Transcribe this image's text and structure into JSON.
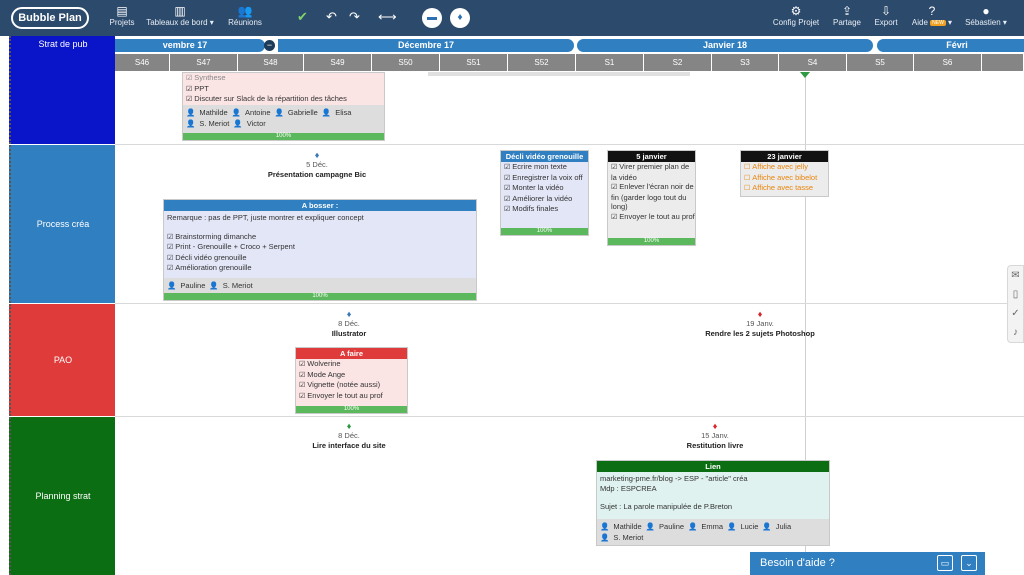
{
  "nav": {
    "logo": "Bubble Plan",
    "projets": "Projets",
    "tableaux": "Tableaux de bord ▾",
    "reunions": "Réunions",
    "config": "Config Projet",
    "partage": "Partage",
    "export": "Export",
    "aide": "Aide",
    "new_badge": "NEW",
    "user": "Sébastien ▾"
  },
  "lanes": [
    "Strat de pub",
    "Process créa",
    "PAO",
    "Planning strat"
  ],
  "months": [
    "vembre 17",
    "Décembre 17",
    "Janvier 18",
    "Févri"
  ],
  "weeks": [
    "S46",
    "S47",
    "S48",
    "S49",
    "S50",
    "S51",
    "S52",
    "S1",
    "S2",
    "S3",
    "S4",
    "S5",
    "S6",
    ""
  ],
  "cards": {
    "c0": {
      "items": [
        "Synthese",
        "PPT",
        "Discuter sur Slack de la répartition des tâches"
      ],
      "users": [
        "Mathilde",
        "Antoine",
        "Gabrielle",
        "Elisa",
        "S. Meriot",
        "Victor"
      ],
      "progress": "100%"
    },
    "c1": {
      "title": "A bosser :",
      "lines": [
        "Remarque : pas de PPT, juste montrer et expliquer concept",
        "",
        "Brainstorming dimanche",
        "Print - Grenouille + Croco + Serpent",
        "Décli vidéo grenouille",
        "Amélioration grenouille"
      ],
      "users": [
        "Pauline",
        "S. Meriot"
      ],
      "progress": "100%"
    },
    "c2": {
      "title": "Décli vidéo grenouille",
      "items": [
        "Ecrire mon texte",
        "Enregistrer la voix off",
        "Monter la vidéo",
        "Améliorer la vidéo",
        "Modifs finales"
      ],
      "progress": "100%"
    },
    "c3": {
      "title": "5 janvier",
      "items": [
        "Virer premier plan de la vidéo",
        "Enlever l'écran noir de fin (garder logo tout du long)",
        "Envoyer le tout au prof"
      ],
      "progress": "100%"
    },
    "c4": {
      "title": "23 janvier",
      "items": [
        "Affiche avec jelly",
        "Affiche avec bibelot",
        "Affiche avec tasse"
      ]
    },
    "c5": {
      "title": "A faire",
      "items": [
        "Wolverine",
        "Mode Ange",
        "Vignette (notée aussi)",
        "Envoyer le tout au prof"
      ],
      "progress": "100%"
    },
    "c6": {
      "title": "Lien",
      "lines": [
        "marketing-pme.fr/blog -> ESP - \"article\" créa",
        "Mdp : ESPCREA",
        "",
        "Sujet : La parole manipulée de P.Breton"
      ],
      "users": [
        "Mathilde",
        "Pauline",
        "Emma",
        "Lucie",
        "Julia",
        "S. Meriot"
      ]
    }
  },
  "milestones": {
    "m1": {
      "date": "5 Déc.",
      "label": "Présentation campagne Bic",
      "color": "#3b78b8"
    },
    "m2": {
      "date": "8 Déc.",
      "label": "Illustrator",
      "color": "#3b78b8"
    },
    "m3": {
      "date": "19 Janv.",
      "label": "Rendre les 2 sujets Photoshop",
      "color": "#d9272e"
    },
    "m4": {
      "date": "8 Déc.",
      "label": "Lire interface du site",
      "color": "#2e9a44"
    },
    "m5": {
      "date": "15 Janv.",
      "label": "Restitution livre",
      "color": "#d9272e"
    }
  },
  "help": {
    "label": "Besoin d'aide ?"
  },
  "colors": {
    "lane1": "#0a14c8",
    "lane2": "#2f7fc1",
    "lane3": "#e03b3b",
    "lane4": "#0b6e13"
  }
}
